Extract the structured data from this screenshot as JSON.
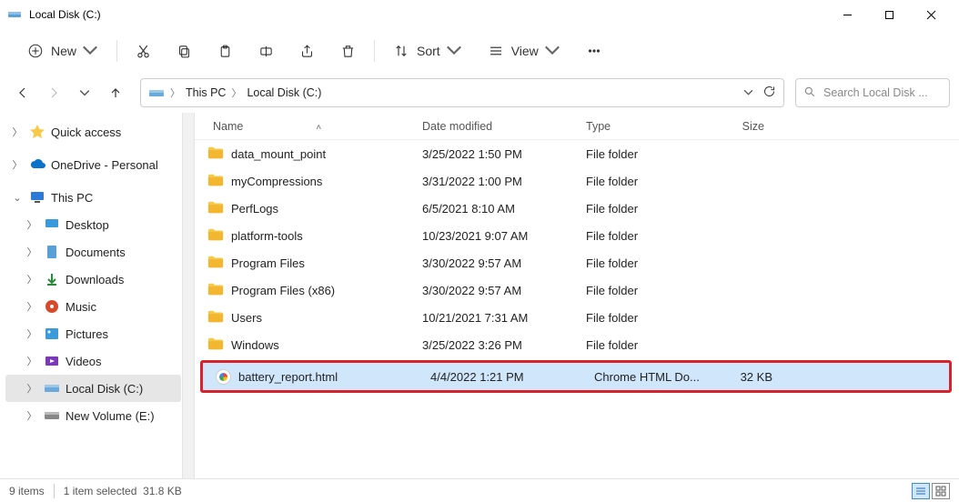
{
  "window": {
    "title": "Local Disk (C:)"
  },
  "toolbar": {
    "new_label": "New",
    "sort_label": "Sort",
    "view_label": "View"
  },
  "breadcrumb": {
    "items": [
      "This PC",
      "Local Disk (C:)"
    ]
  },
  "search": {
    "placeholder": "Search Local Disk ..."
  },
  "sidebar": {
    "quick_access": "Quick access",
    "onedrive": "OneDrive - Personal",
    "this_pc": "This PC",
    "children": {
      "desktop": "Desktop",
      "documents": "Documents",
      "downloads": "Downloads",
      "music": "Music",
      "pictures": "Pictures",
      "videos": "Videos",
      "local_disk": "Local Disk (C:)",
      "new_volume": "New Volume (E:)"
    }
  },
  "columns": {
    "name": "Name",
    "date_modified": "Date modified",
    "type": "Type",
    "size": "Size"
  },
  "files": [
    {
      "name": "data_mount_point",
      "modified": "3/25/2022 1:50 PM",
      "type": "File folder",
      "size": "",
      "kind": "folder",
      "selected": false
    },
    {
      "name": "myCompressions",
      "modified": "3/31/2022 1:00 PM",
      "type": "File folder",
      "size": "",
      "kind": "folder",
      "selected": false
    },
    {
      "name": "PerfLogs",
      "modified": "6/5/2021 8:10 AM",
      "type": "File folder",
      "size": "",
      "kind": "folder",
      "selected": false
    },
    {
      "name": "platform-tools",
      "modified": "10/23/2021 9:07 AM",
      "type": "File folder",
      "size": "",
      "kind": "folder",
      "selected": false
    },
    {
      "name": "Program Files",
      "modified": "3/30/2022 9:57 AM",
      "type": "File folder",
      "size": "",
      "kind": "folder",
      "selected": false
    },
    {
      "name": "Program Files (x86)",
      "modified": "3/30/2022 9:57 AM",
      "type": "File folder",
      "size": "",
      "kind": "folder",
      "selected": false
    },
    {
      "name": "Users",
      "modified": "10/21/2021 7:31 AM",
      "type": "File folder",
      "size": "",
      "kind": "folder",
      "selected": false
    },
    {
      "name": "Windows",
      "modified": "3/25/2022 3:26 PM",
      "type": "File folder",
      "size": "",
      "kind": "folder",
      "selected": false
    },
    {
      "name": "battery_report.html",
      "modified": "4/4/2022 1:21 PM",
      "type": "Chrome HTML Do...",
      "size": "32 KB",
      "kind": "html",
      "selected": true
    }
  ],
  "status": {
    "count": "9 items",
    "selection": "1 item selected",
    "sel_size": "31.8 KB"
  }
}
